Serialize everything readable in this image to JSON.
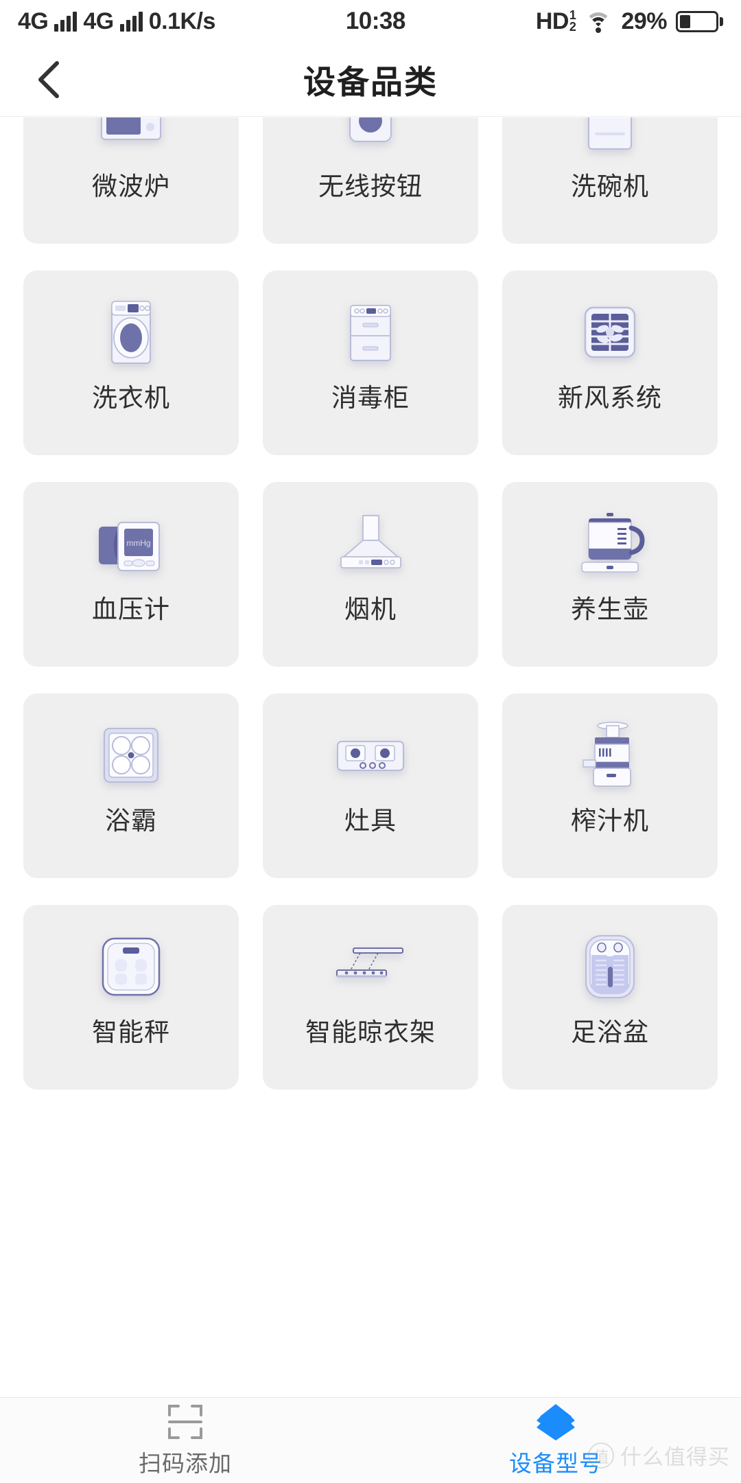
{
  "statusbar": {
    "network1": "4G",
    "network2": "4G",
    "datarate": "0.1K/s",
    "time": "10:38",
    "hd_label": "HD",
    "hd_sup": "1",
    "hd_sub": "2",
    "battery_percent": "29%",
    "battery_level": 29
  },
  "header": {
    "title": "设备品类",
    "back_icon": "chevron-left-icon"
  },
  "grid": {
    "items": [
      {
        "label": "微波炉",
        "icon": "microwave-icon",
        "clipped": true
      },
      {
        "label": "无线按钮",
        "icon": "wireless-button-icon",
        "clipped": true
      },
      {
        "label": "洗碗机",
        "icon": "dishwasher-icon",
        "clipped": true
      },
      {
        "label": "洗衣机",
        "icon": "washing-machine-icon",
        "clipped": false
      },
      {
        "label": "消毒柜",
        "icon": "sterilizer-cabinet-icon",
        "clipped": false
      },
      {
        "label": "新风系统",
        "icon": "fresh-air-system-icon",
        "clipped": false
      },
      {
        "label": "血压计",
        "icon": "blood-pressure-monitor-icon",
        "clipped": false
      },
      {
        "label": "烟机",
        "icon": "range-hood-icon",
        "clipped": false
      },
      {
        "label": "养生壶",
        "icon": "health-kettle-icon",
        "clipped": false
      },
      {
        "label": "浴霸",
        "icon": "bath-heater-icon",
        "clipped": false
      },
      {
        "label": "灶具",
        "icon": "gas-stove-icon",
        "clipped": false
      },
      {
        "label": "榨汁机",
        "icon": "juicer-icon",
        "clipped": false
      },
      {
        "label": "智能秤",
        "icon": "smart-scale-icon",
        "clipped": false
      },
      {
        "label": "智能晾衣架",
        "icon": "smart-drying-rack-icon",
        "clipped": false
      },
      {
        "label": "足浴盆",
        "icon": "foot-spa-icon",
        "clipped": false
      }
    ],
    "icon_text": {
      "blood_pressure_display": "mmHg"
    }
  },
  "bottomnav": {
    "items": [
      {
        "label": "扫码添加",
        "icon": "scan-code-icon",
        "active": false
      },
      {
        "label": "设备型号",
        "icon": "device-model-icon",
        "active": true
      }
    ],
    "active_color": "#1a8cfb",
    "inactive_color": "#6a6a6a"
  },
  "watermark": {
    "logo_char": "值",
    "text": "什么值得买"
  }
}
